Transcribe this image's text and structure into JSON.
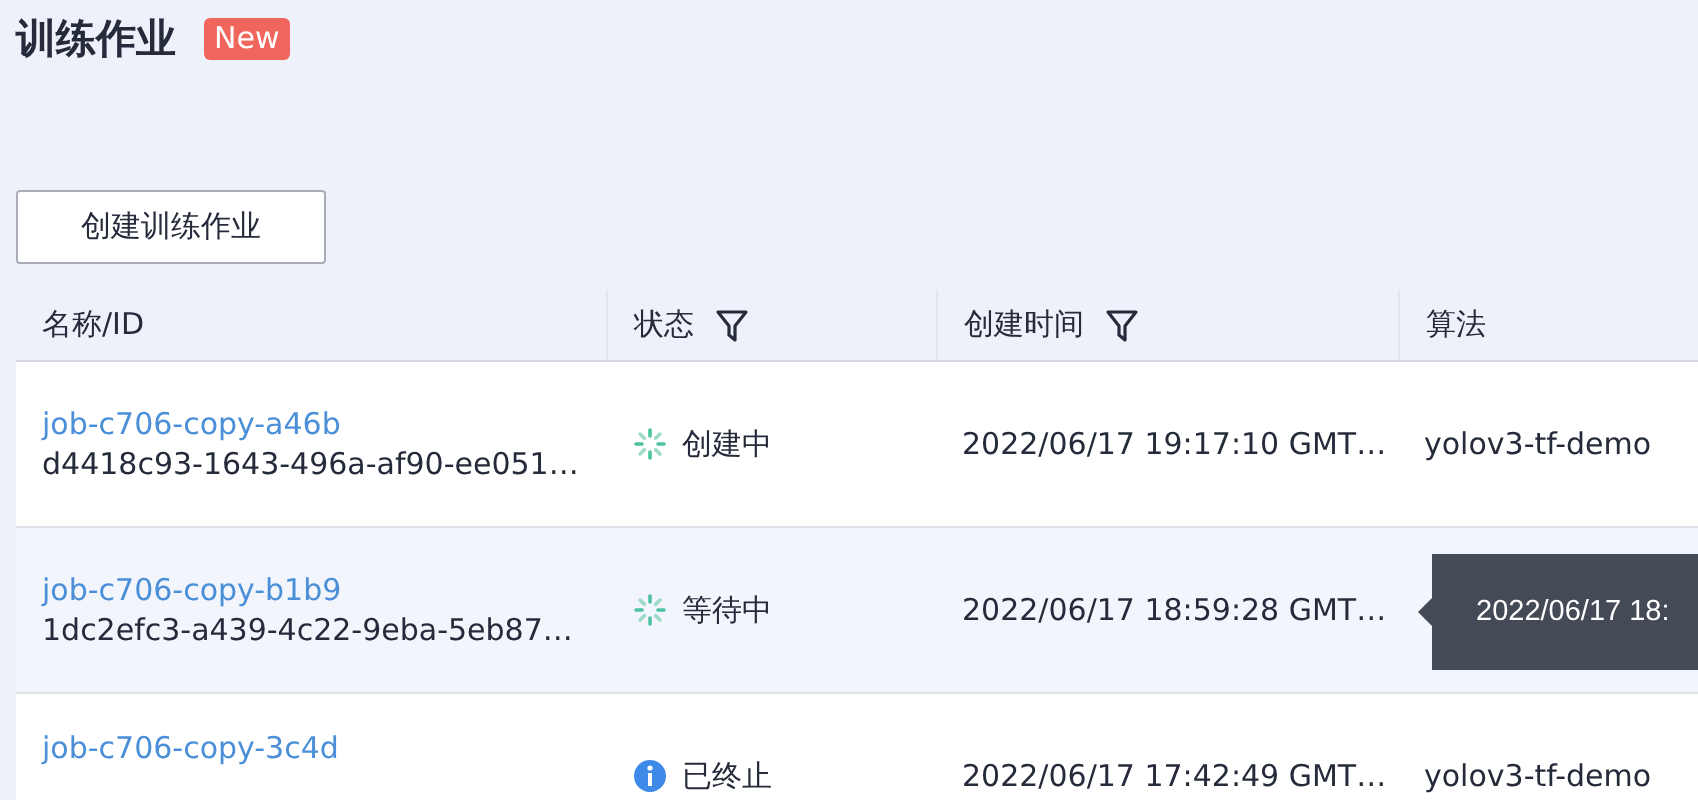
{
  "page": {
    "title": "训练作业",
    "badge": "New"
  },
  "create_button": "创建训练作业",
  "table": {
    "columns": [
      {
        "label": "名称/ID",
        "filter": false
      },
      {
        "label": "状态",
        "filter": true
      },
      {
        "label": "创建时间",
        "filter": true
      },
      {
        "label": "算法",
        "filter": false
      }
    ],
    "rows": [
      {
        "name": "job-c706-copy-a46b",
        "id": "d4418c93-1643-496a-af90-ee051…",
        "status": {
          "kind": "spinner",
          "label": "创建中"
        },
        "created": "2022/06/17 19:17:10 GMT…",
        "algorithm": "yolov3-tf-demo",
        "hovered": false
      },
      {
        "name": "job-c706-copy-b1b9",
        "id": "1dc2efc3-a439-4c22-9eba-5eb87…",
        "status": {
          "kind": "spinner",
          "label": "等待中"
        },
        "created": "2022/06/17 18:59:28 GMT…",
        "hovered": true
      },
      {
        "name": "job-c706-copy-3c4d",
        "status": {
          "kind": "info",
          "label": "已终止"
        },
        "created": "2022/06/17 17:42:49 GMT…",
        "algorithm": "yolov3-tf-demo",
        "hovered": false
      }
    ]
  },
  "tooltip": {
    "text": "2022/06/17 18:"
  }
}
